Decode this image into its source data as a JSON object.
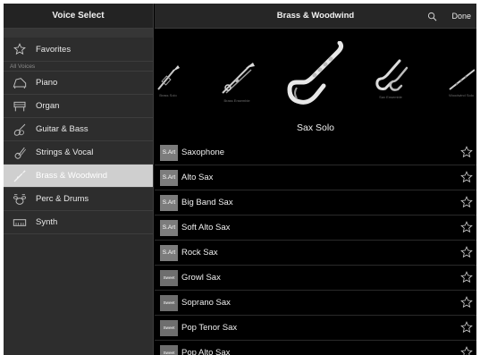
{
  "sidebar": {
    "title": "Voice Select",
    "favorites_label": "Favorites",
    "section_label": "All Voices",
    "items": [
      {
        "label": "Piano",
        "icon": "piano-icon"
      },
      {
        "label": "Organ",
        "icon": "organ-icon"
      },
      {
        "label": "Guitar & Bass",
        "icon": "guitar-icon"
      },
      {
        "label": "Strings & Vocal",
        "icon": "violin-icon"
      },
      {
        "label": "Brass & Woodwind",
        "icon": "trumpet-icon",
        "selected": true
      },
      {
        "label": "Perc & Drums",
        "icon": "drum-kit-icon"
      },
      {
        "label": "Synth",
        "icon": "synth-icon"
      }
    ]
  },
  "header": {
    "title": "Brass & Woodwind",
    "done_label": "Done",
    "search_icon": "search-icon"
  },
  "carousel": {
    "items": [
      {
        "caption": "Brass Solo",
        "icon": "trumpet-icon"
      },
      {
        "caption": "Brass Ensemble",
        "icon": "trombone-icon"
      },
      {
        "caption": "",
        "icon": "saxophone-icon",
        "selected": true
      },
      {
        "caption": "Sax Ensemble",
        "icon": "sax-ensemble-icon"
      },
      {
        "caption": "Woodwind Solo",
        "icon": "flute-icon"
      }
    ],
    "selected_name": "Sax Solo"
  },
  "voices": [
    {
      "badge": "S.Art",
      "name": "Saxophone"
    },
    {
      "badge": "S.Art",
      "name": "Alto Sax"
    },
    {
      "badge": "S.Art",
      "name": "Big Band Sax"
    },
    {
      "badge": "S.Art",
      "name": "Soft Alto Sax"
    },
    {
      "badge": "S.Art",
      "name": "Rock Sax"
    },
    {
      "badge": "Sweet",
      "name": "Growl Sax"
    },
    {
      "badge": "Sweet",
      "name": "Soprano Sax"
    },
    {
      "badge": "Sweet",
      "name": "Pop Tenor Sax"
    },
    {
      "badge": "Sweet",
      "name": "Pop Alto Sax"
    }
  ],
  "colors": {
    "background": "#000000",
    "sidebar": "#2d2d2d",
    "selected_row": "#cfcfcf",
    "badge": "#7c7c7c"
  }
}
